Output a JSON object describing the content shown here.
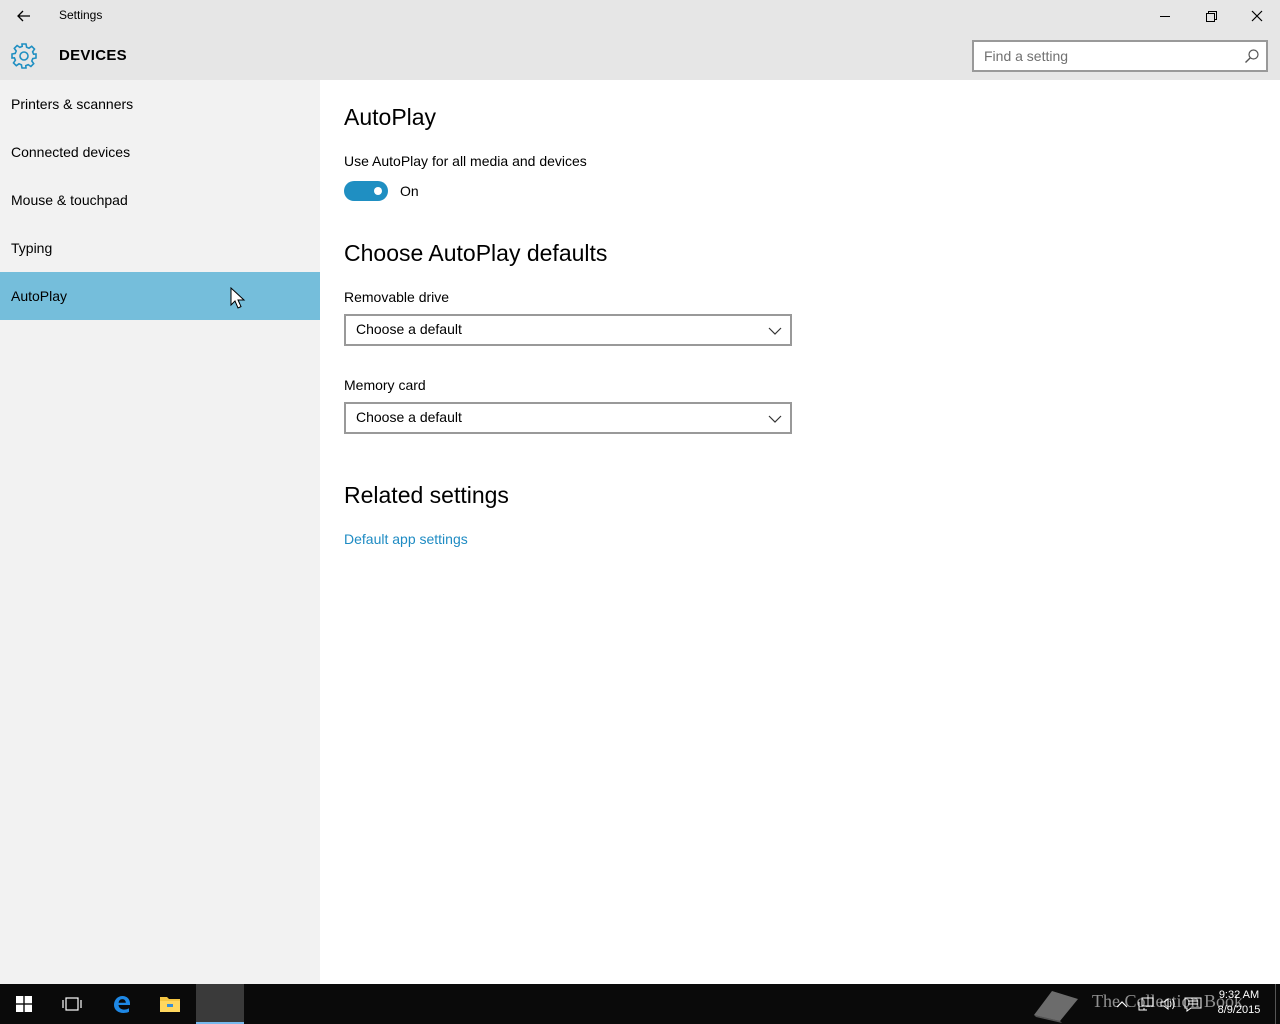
{
  "window": {
    "title": "Settings",
    "minimize_label": "Minimize",
    "restore_label": "Restore",
    "close_label": "Close"
  },
  "header": {
    "section_title": "DEVICES",
    "search_placeholder": "Find a setting"
  },
  "sidebar": {
    "items": [
      {
        "label": "Printers & scanners",
        "active": false
      },
      {
        "label": "Connected devices",
        "active": false
      },
      {
        "label": "Mouse & touchpad",
        "active": false
      },
      {
        "label": "Typing",
        "active": false
      },
      {
        "label": "AutoPlay",
        "active": true
      }
    ]
  },
  "main": {
    "title": "AutoPlay",
    "toggle_label": "Use AutoPlay for all media and devices",
    "toggle_state": "On",
    "defaults_heading": "Choose AutoPlay defaults",
    "removable_drive": {
      "label": "Removable drive",
      "value": "Choose a default"
    },
    "memory_card": {
      "label": "Memory card",
      "value": "Choose a default"
    },
    "related_heading": "Related settings",
    "related_link": "Default app settings"
  },
  "taskbar": {
    "clock_time": "9:32 AM",
    "clock_date": "8/9/2015",
    "watermark": "The Collection Book"
  },
  "colors": {
    "accent": "#1f8fc2",
    "nav_selected": "#75bedb",
    "link": "#1e8bc3",
    "chrome": "#e6e6e6",
    "sidebar_bg": "#f2f2f2",
    "taskbar_bg": "#0a0a0a"
  }
}
